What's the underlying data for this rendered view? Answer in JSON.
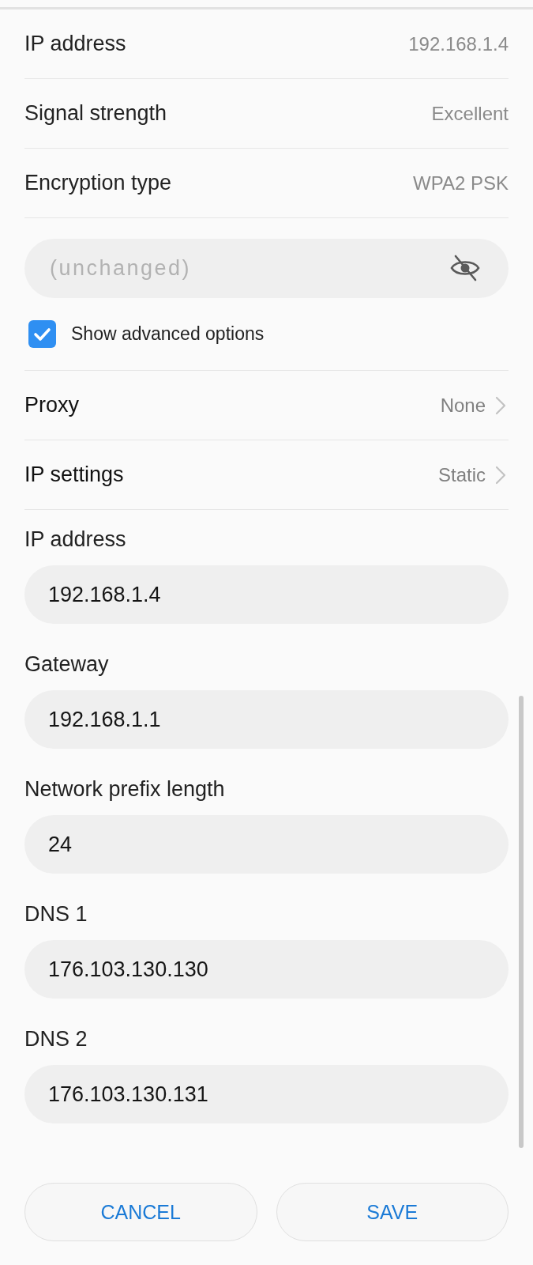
{
  "info_rows": [
    {
      "label": "IP address",
      "value": "192.168.1.4"
    },
    {
      "label": "Signal strength",
      "value": "Excellent"
    },
    {
      "label": "Encryption type",
      "value": "WPA2 PSK"
    }
  ],
  "password": {
    "placeholder": "(unchanged)"
  },
  "advanced": {
    "label": "Show advanced options",
    "checked": true
  },
  "settings_rows": [
    {
      "label": "Proxy",
      "value": "None"
    },
    {
      "label": "IP settings",
      "value": "Static"
    }
  ],
  "ip_fields": [
    {
      "label": "IP address",
      "value": "192.168.1.4"
    },
    {
      "label": "Gateway",
      "value": "192.168.1.1"
    },
    {
      "label": "Network prefix length",
      "value": "24"
    },
    {
      "label": "DNS 1",
      "value": "176.103.130.130"
    },
    {
      "label": "DNS 2",
      "value": "176.103.130.131"
    }
  ],
  "buttons": [
    "CANCEL",
    "SAVE"
  ]
}
